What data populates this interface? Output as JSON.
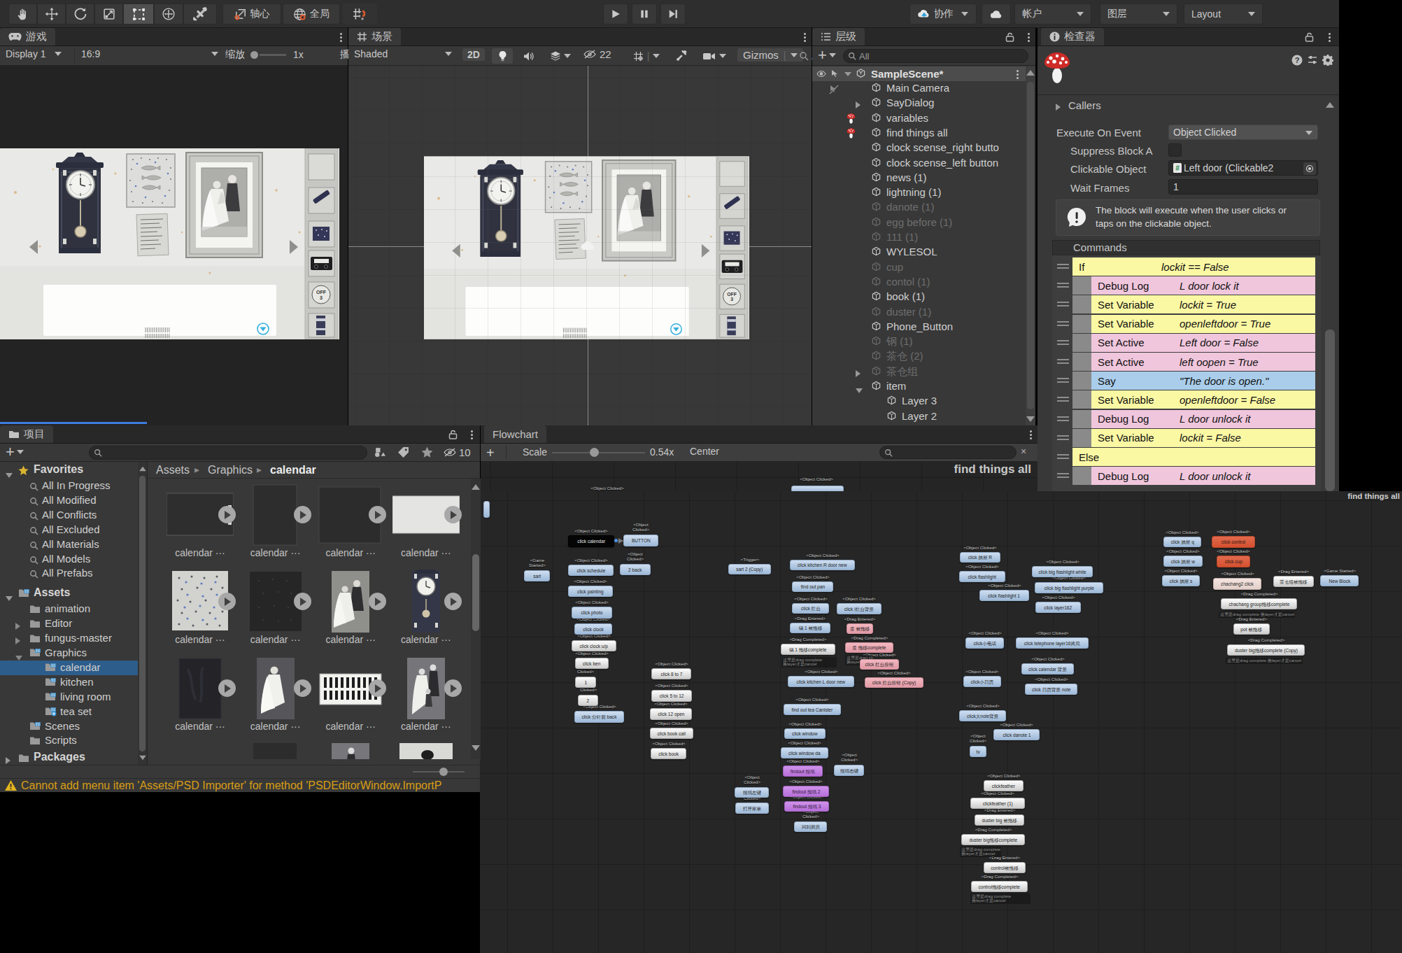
{
  "toolbar": {
    "pivot_label": "轴心",
    "global_label": "全局",
    "collab_label": "协作",
    "account_label": "帐户",
    "layers_label": "图层",
    "layout_label": "Layout"
  },
  "game": {
    "tab": "游戏",
    "display": "Display 1",
    "aspect": "16:9",
    "zoom_label": "缩放",
    "zoom_value": "1x",
    "play_clip": "播"
  },
  "scene": {
    "tab": "场景",
    "draw_mode": "Shaded",
    "btn_2d": "2D",
    "vis_count": "22",
    "gizmos": "Gizmos",
    "search_clip": "A"
  },
  "hierarchy": {
    "tab": "层级",
    "search": "All",
    "scene_name": "SampleScene*",
    "items": [
      {
        "t": "Main Camera",
        "nopick": 1
      },
      {
        "t": "SayDialog",
        "arrow": "r"
      },
      {
        "t": "variables",
        "fungus": 1
      },
      {
        "t": "find things all",
        "fungus": 1
      },
      {
        "t": "clock scense_right butto"
      },
      {
        "t": "clock scense_left button"
      },
      {
        "t": "news  (1)"
      },
      {
        "t": "lightning (1)"
      },
      {
        "t": "danote (1)",
        "dim": 1
      },
      {
        "t": "egg before (1)",
        "dim": 1
      },
      {
        "t": "111 (1)",
        "dim": 1
      },
      {
        "t": "WYLESOL"
      },
      {
        "t": "cup",
        "dim": 1
      },
      {
        "t": "contol (1)",
        "dim": 1
      },
      {
        "t": "book (1)"
      },
      {
        "t": "duster (1)",
        "dim": 1
      },
      {
        "t": "Phone_Button"
      },
      {
        "t": "钢 (1)",
        "dim": 1
      },
      {
        "t": "茶仓 (2)",
        "dim": 1
      },
      {
        "t": "茶仓组",
        "dim": 1,
        "arrow": "r"
      },
      {
        "t": "item",
        "arrow": "d"
      },
      {
        "t": "Layer 3",
        "ind": 1
      },
      {
        "t": "Layer 2",
        "ind": 1
      }
    ]
  },
  "inspector": {
    "tab": "检查器",
    "callers": "Callers",
    "execute_label": "Execute On Event",
    "execute_value": "Object Clicked",
    "suppress_label": "Suppress Block A",
    "clickable_label": "Clickable Object",
    "clickable_value": "Left door (Clickable2",
    "wait_label": "Wait Frames",
    "wait_value": "1",
    "help_line1": "The block will execute when the user clicks or",
    "help_line2": "taps on the clickable object.",
    "commands_header": "Commands",
    "commands": [
      [
        "If",
        "lockit == False",
        "y",
        0
      ],
      [
        "Debug Log",
        "L door lock it",
        "p",
        1
      ],
      [
        "Set Variable",
        "lockit = True",
        "y",
        1
      ],
      [
        "Set Variable",
        "openleftdoor = True",
        "y",
        1
      ],
      [
        "Set Active",
        "Left door = False",
        "p",
        1
      ],
      [
        "Set Active",
        "left oopen = True",
        "p",
        1
      ],
      [
        "Say",
        "\"The door is open.\"",
        "b",
        1
      ],
      [
        "Set Variable",
        "openleftdoor = False",
        "y",
        1
      ],
      [
        "Debug Log",
        "L door unlock it",
        "p",
        1
      ],
      [
        "Set Variable",
        "lockit = False",
        "y",
        1
      ],
      [
        "Else",
        "",
        "y",
        0
      ],
      [
        "Debug Log",
        "L door unlock it",
        "p",
        1
      ]
    ]
  },
  "project": {
    "tab": "项目",
    "crumbs": [
      "Assets",
      "Graphics",
      "calendar"
    ],
    "vis_count": "10",
    "favorites_label": "Favorites",
    "favorites": [
      "All In Progress",
      "All Modified",
      "All Conflicts",
      "All Excluded",
      "All Materials",
      "All Models",
      "All Prefabs"
    ],
    "assets_label": "Assets",
    "tree": [
      {
        "t": "animation"
      },
      {
        "t": "Editor",
        "arrow": 1
      },
      {
        "t": "fungus-master",
        "arrow": 1
      },
      {
        "t": "Graphics",
        "open": 1,
        "badge": 1
      },
      {
        "t": "calendar",
        "sel": 1,
        "ind": 1,
        "badge": 1
      },
      {
        "t": "kitchen",
        "ind": 1,
        "badge": 1
      },
      {
        "t": "living room",
        "ind": 1,
        "badge": 1
      },
      {
        "t": "tea set",
        "ind": 1,
        "plus": 1
      },
      {
        "t": "Scenes",
        "badge": 1
      },
      {
        "t": "Scripts"
      }
    ],
    "packages_label": "Packages",
    "tile_label": "calendar ···",
    "tiles": [
      {
        "k": "framemarks"
      },
      {
        "k": "darkrect"
      },
      {
        "k": "darkrect2"
      },
      {
        "k": "lightrect"
      },
      {
        "k": "polka"
      },
      {
        "k": "darkfabric"
      },
      {
        "k": "wedding"
      },
      {
        "k": "clock"
      },
      {
        "k": "rug"
      },
      {
        "k": "bride"
      },
      {
        "k": "radiator"
      },
      {
        "k": "couple"
      },
      {
        "k": "none"
      },
      {
        "k": "sliver-dark"
      },
      {
        "k": "sliver-photo"
      },
      {
        "k": "sliver-light"
      }
    ],
    "status": "Cannot add menu item 'Assets/PSD Importer' for method 'PSDEditorWindow.ImportP"
  },
  "flowchart": {
    "tab": "Flowchart",
    "scale_label": "Scale",
    "scale_value": "0.54x",
    "center_label": "Center",
    "title": "find things all",
    "caps_a": [
      [
        832,
        694,
        "<Object Clicked>"
      ],
      [
        1131,
        681,
        "<Object Clicked>"
      ]
    ],
    "nodes": [
      [
        812,
        765,
        66,
        17,
        "black",
        "click calendar",
        "<Object Clicked>",
        1
      ],
      [
        891,
        764,
        50,
        17,
        "blue",
        "BUTTON",
        "<Object Clicked>",
        2
      ],
      [
        749,
        815,
        37,
        16,
        "blue",
        "sart",
        "<Game Started>",
        2
      ],
      [
        812,
        807,
        65,
        16,
        "blue",
        "click schedule",
        "<Object Clicked>",
        1
      ],
      [
        886,
        806,
        44,
        16,
        "blue",
        "2 back",
        "<Object Clicked>",
        2
      ],
      [
        812,
        837,
        64,
        16,
        "blue",
        "click painting",
        "<Object Clicked>",
        1
      ],
      [
        817,
        867,
        58,
        17,
        "blue",
        "click photo",
        "<Object Clicked>",
        1
      ],
      [
        821,
        891,
        54,
        16,
        "blue",
        "click clock",
        "<Object Clicked>",
        1
      ],
      [
        817,
        915,
        64,
        16,
        "white",
        "click clock u/p",
        "<Object Clicked>",
        1
      ],
      [
        822,
        940,
        48,
        16,
        "white",
        "click ben",
        "<Object Clicked>",
        1
      ],
      [
        822,
        967,
        30,
        16,
        "white",
        "1",
        "<Object Clicked>",
        2
      ],
      [
        826,
        993,
        29,
        16,
        "white",
        "2",
        "<Object Clicked>",
        2
      ],
      [
        821,
        1016,
        71,
        17,
        "blue",
        "click 分针前 back",
        "<Object Clicked>",
        1
      ],
      [
        931,
        955,
        57,
        16,
        "white",
        "click 8 to 7",
        "<Object Clicked>",
        1
      ],
      [
        931,
        986,
        58,
        17,
        "white",
        "click 5 to 12",
        "<Object Clicked>",
        1
      ],
      [
        929,
        1012,
        60,
        17,
        "white",
        "click 12 open",
        "<Object Clicked>",
        1
      ],
      [
        929,
        1040,
        62,
        16,
        "white",
        "click book call",
        "<Object Clicked>",
        1
      ],
      [
        930,
        1069,
        51,
        16,
        "white",
        "click book",
        "<Object Clicked>",
        1
      ],
      [
        1041,
        806,
        61,
        15,
        "blue",
        "sart 2 (Copy)",
        "<Trigger>",
        1
      ],
      [
        1129,
        800,
        93,
        15,
        "blue",
        "click kitchen R door new",
        "<Object Clicked>",
        1
      ],
      [
        1132,
        831,
        59,
        15,
        "blue",
        "find out pan",
        "<Object Clicked>",
        1
      ],
      [
        1132,
        862,
        53,
        15,
        "blue",
        "click 灶台",
        "<Object Clicked>",
        1
      ],
      [
        1196,
        862,
        64,
        16,
        "blue",
        "click l灶台背景",
        "<Object Clicked>",
        1
      ],
      [
        1129,
        890,
        58,
        15,
        "blue",
        "锅 1 被拖移",
        "<Drag Entered>",
        1
      ],
      [
        1210,
        891,
        38,
        15,
        "pink",
        "蛋 被拖移",
        "<Drag Entered>",
        1
      ],
      [
        1116,
        920,
        78,
        16,
        "white",
        "锅 1 拖移complete",
        "<Drag Completed>",
        1
      ],
      [
        1208,
        918,
        69,
        15,
        "pink",
        "蛋 拖移complete",
        "<Drag Completed>",
        1
      ],
      [
        1229,
        942,
        56,
        15,
        "pink",
        "click 灶台按钮",
        "<Object Clicked>",
        1
      ],
      [
        1236,
        968,
        84,
        15,
        "pink",
        "click 灶台按钮 (Copy)",
        "<Object Clicked>",
        1
      ],
      [
        1126,
        966,
        95,
        16,
        "blue",
        "click kitchen L door new",
        "<Object Clicked>",
        1
      ],
      [
        1120,
        1006,
        82,
        16,
        "blue",
        "find out tea Canister",
        "<Object Clicked>",
        1
      ],
      [
        1121,
        1041,
        59,
        15,
        "blue",
        "click window",
        "<Object Clicked>",
        1
      ],
      [
        1116,
        1068,
        68,
        16,
        "blue",
        "click window da",
        "<Object Clicked>",
        1
      ],
      [
        1119,
        1094,
        57,
        16,
        "purple",
        "findout 报纸",
        "<Object Clicked>",
        1
      ],
      [
        1192,
        1093,
        43,
        16,
        "blue",
        "报纸右键",
        "<Object Clicked>",
        2
      ],
      [
        1050,
        1125,
        49,
        15,
        "blue",
        "报纸左键",
        "<Object Clicked>",
        2
      ],
      [
        1119,
        1123,
        66,
        16,
        "purple",
        "findout 报纸 2",
        "<Object Clicked>",
        1
      ],
      [
        1121,
        1145,
        64,
        15,
        "purple",
        "findout 报纸 3",
        "<Object Clicked>",
        1
      ],
      [
        1051,
        1147,
        48,
        16,
        "blue",
        "打开家暴",
        "Clicked>",
        1
      ],
      [
        1135,
        1174,
        47,
        15,
        "blue",
        "回到厨房",
        "<Object Clicked>",
        2
      ],
      [
        1372,
        789,
        58,
        15,
        "blue",
        "click 抽屉 R",
        "<Object Clicked>",
        1
      ],
      [
        1371,
        816,
        66,
        16,
        "blue",
        "click flashlight",
        "<Object Clicked>",
        1
      ],
      [
        1400,
        843,
        71,
        16,
        "blue",
        "click flashlight  1",
        "<Object Clicked>",
        1
      ],
      [
        1475,
        809,
        87,
        16,
        "blue",
        "click big flashlight  white",
        "<Object Clicked>",
        1
      ],
      [
        1479,
        832,
        98,
        16,
        "blue",
        "click big flashlight  purple",
        "<Object Clicked>",
        1
      ],
      [
        1480,
        860,
        65,
        16,
        "blue",
        "click layer162",
        "<Object Clicked>",
        1
      ],
      [
        1380,
        911,
        55,
        16,
        "blue",
        "click小电话",
        "<Object Clicked>",
        1
      ],
      [
        1452,
        911,
        104,
        16,
        "blue",
        "click telephone layer16拷贝",
        "<Object Clicked>",
        1
      ],
      [
        1460,
        948,
        75,
        16,
        "blue",
        "click calendar 背景",
        "<Object Clicked>",
        1
      ],
      [
        1377,
        966,
        54,
        16,
        "blue",
        "click小日历",
        "<Object Clicked>",
        1
      ],
      [
        1465,
        977,
        75,
        16,
        "blue",
        "click 日历背景 note",
        "<Object Clicked>",
        1
      ],
      [
        1371,
        1015,
        67,
        16,
        "blue",
        "click大note背景",
        "<Object Clicked>",
        1
      ],
      [
        1420,
        1042,
        66,
        16,
        "blue",
        "click danote  1",
        "<Object Clicked>",
        1
      ],
      [
        1386,
        1066,
        24,
        16,
        "blue",
        "tv",
        "<Object Clicked>",
        2
      ],
      [
        1406,
        1115,
        57,
        16,
        "white",
        "clickfeather",
        "<Object Clicked>",
        1
      ],
      [
        1387,
        1140,
        78,
        16,
        "white",
        "clickfeather  (1)",
        "<Object Clicked>",
        1
      ],
      [
        1393,
        1164,
        71,
        16,
        "white",
        "duster big 被拖移",
        "<Drag Entered>",
        1
      ],
      [
        1374,
        1192,
        91,
        16,
        "white",
        "duster big拖移complete",
        "<Drag Completed>",
        1
      ],
      [
        1406,
        1232,
        60,
        16,
        "white",
        "control被拖移",
        "<Drag Entered>",
        1
      ],
      [
        1388,
        1259,
        81,
        16,
        "white",
        "control拖移complete",
        "<Drag Completed>",
        1
      ],
      [
        1663,
        767,
        54,
        15,
        "blue",
        "click 抽屉 q",
        "<Object Clicked>",
        1
      ],
      [
        1663,
        794,
        56,
        16,
        "blue",
        "click 抽屉 w",
        "<Object Clicked>",
        1
      ],
      [
        1661,
        822,
        54,
        16,
        "blue",
        "click 抽屉 s",
        "<Object Clicked>",
        1
      ],
      [
        1732,
        766,
        62,
        17,
        "red",
        "click control",
        "<Object Clicked>",
        1
      ],
      [
        1739,
        794,
        48,
        17,
        "red",
        "click cup",
        "<Object Clicked>",
        1
      ],
      [
        1734,
        826,
        69,
        17,
        "pale",
        "chachang2 click",
        "<Object Clicked>",
        1
      ],
      [
        1820,
        823,
        58,
        16,
        "white",
        "茶仓组被拖移",
        "<Drag Entered>",
        1
      ],
      [
        1887,
        822,
        55,
        16,
        "blue",
        "New Block",
        "<Game Started>",
        1
      ],
      [
        1745,
        855,
        109,
        16,
        "white",
        "chachang group拖移complete",
        "<Drag Completed>",
        1
      ],
      [
        1763,
        891,
        52,
        16,
        "white",
        "pot 被拖移",
        "<Drag Entered>",
        1
      ],
      [
        1754,
        921,
        111,
        16,
        "white",
        "duster big拖移complete (Copy)",
        "<Drag Completed>",
        1
      ],
      [
        691,
        716,
        9,
        24,
        "blue",
        "",
        "",
        0
      ]
    ],
    "notes": [
      [
        1117,
        939,
        79,
        "这里是drag complete",
        "换layer才是cancel"
      ],
      [
        1208,
        936,
        40,
        "这里是drag complete",
        "换layer才是cancel"
      ],
      [
        1372,
        1210,
        59,
        "这里是drag complete",
        "换layer才是cancel"
      ],
      [
        1387,
        1277,
        86,
        "这里是drag complete",
        "换layer才是cancel"
      ],
      [
        1742,
        874,
        109,
        "这里是drag complete 换layer才是cancel",
        ""
      ],
      [
        1752,
        940,
        110,
        "这里是drag complete 换layer才是cancel",
        ""
      ]
    ]
  }
}
